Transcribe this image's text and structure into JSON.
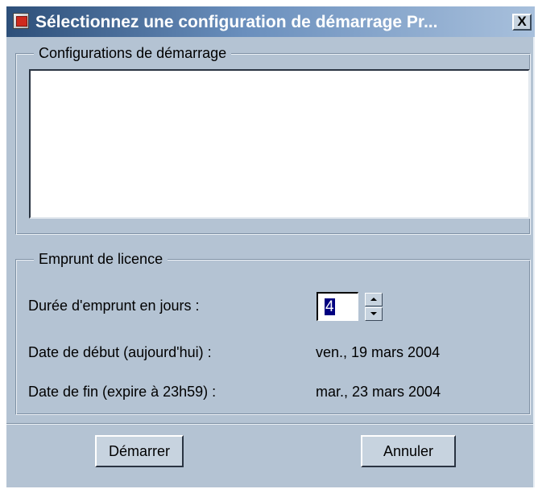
{
  "window": {
    "title": "Sélectionnez une configuration de démarrage Pr...",
    "close_label": "X"
  },
  "startup_configs": {
    "legend": "Configurations de démarrage",
    "items": []
  },
  "license_borrow": {
    "legend": "Emprunt de licence",
    "duration_label": "Durée d'emprunt en jours :",
    "duration_value": "4",
    "start_date_label": "Date de début (aujourd'hui) :",
    "start_date_value": "ven., 19 mars 2004",
    "end_date_label": "Date de fin (expire à 23h59) :",
    "end_date_value": "mar., 23 mars 2004"
  },
  "buttons": {
    "start_label": "Démarrer",
    "cancel_label": "Annuler"
  },
  "colors": {
    "dialog_background": "#b4c3d3",
    "titlebar_start": "#2d4f79",
    "titlebar_end": "#a8c0dc"
  }
}
